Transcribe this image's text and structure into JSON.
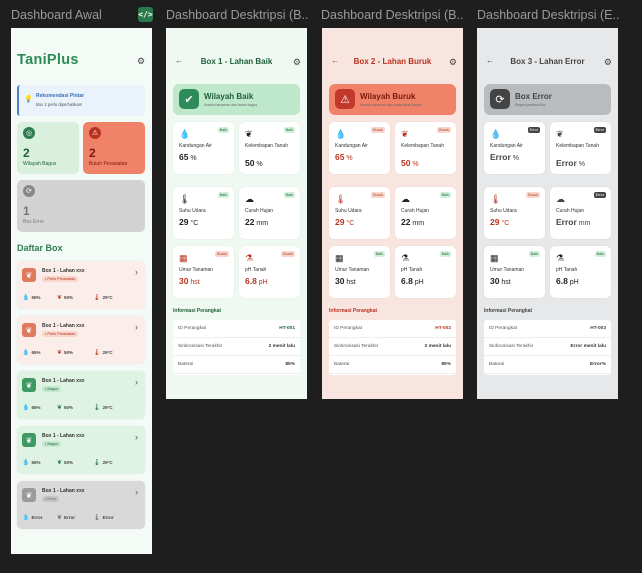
{
  "frame_titles": [
    "Dashboard Awal",
    "Dashboard Desktripsi (B...",
    "Dashboard Desktripsi (B...",
    "Dashboard Desktripsi (E..."
  ],
  "code_icon": "</>",
  "main": {
    "logo": "TaniPlus",
    "recommend_title": "Rekomendasi Pintar",
    "recommend_text": "Box 2 perlu diperhatikan!",
    "good_count": "2",
    "good_label": "Wilayah Bagus",
    "bad_count": "2",
    "bad_label": "Butuh Perawatan",
    "error_count": "1",
    "error_label": "Box Error",
    "list_title": "Daftar Box",
    "boxes": [
      {
        "title": "Box 1 - Lahan xxx",
        "status": "Perlu Perawatan",
        "kind": "bad",
        "moisture": "65%",
        "humidity": "50%",
        "temp": "29°C"
      },
      {
        "title": "Box 1 - Lahan xxx",
        "status": "Perlu Perawatan",
        "kind": "bad",
        "moisture": "65%",
        "humidity": "50%",
        "temp": "29°C"
      },
      {
        "title": "Box 1 - Lahan xxx",
        "status": "Bagus",
        "kind": "good",
        "moisture": "65%",
        "humidity": "50%",
        "temp": "29°C"
      },
      {
        "title": "Box 1 - Lahan xxx",
        "status": "Bagus",
        "kind": "good",
        "moisture": "65%",
        "humidity": "50%",
        "temp": "29°C"
      },
      {
        "title": "Box 1 - Lahan xxx",
        "status": "Error",
        "kind": "err",
        "moisture": "Error",
        "humidity": "Error",
        "temp": "Error"
      }
    ]
  },
  "details": [
    {
      "theme": "good",
      "title": "Box 1 - Lahan Baik",
      "banner_title": "Wilayah Baik",
      "banner_sub": "Kondisi tanaman dan tanah bagus",
      "sensors": [
        {
          "label": "Kandungan Air",
          "value": "65",
          "unit": " %",
          "badge": "Baik",
          "bstate": "good"
        },
        {
          "label": "Kelembapan Tanah",
          "value": "50",
          "unit": " %",
          "badge": "Baik",
          "bstate": "good"
        },
        {
          "label": "Suhu Udara",
          "value": "29",
          "unit": " °C",
          "badge": "Baik",
          "bstate": "good"
        },
        {
          "label": "Curah Hujan",
          "value": "22",
          "unit": " mm",
          "badge": "Baik",
          "bstate": "good"
        },
        {
          "label": "Umur Tanaman",
          "value": "30",
          "unit": " hst",
          "badge": "Buruk",
          "bstate": "bad"
        },
        {
          "label": "pH Tanah",
          "value": "6.8",
          "unit": " pH",
          "badge": "Buruk",
          "bstate": "bad"
        }
      ],
      "info_title": "Informasi Perangkat",
      "info": [
        {
          "k": "ID Perangkat",
          "v": "HT-001"
        },
        {
          "k": "Sinkronisasi Terakhir",
          "v": "2  menit lalu"
        },
        {
          "k": "Baterai",
          "v": "85%"
        }
      ]
    },
    {
      "theme": "bad",
      "title": "Box 2 - Lahan Buruk",
      "banner_title": "Wilayah Buruk",
      "banner_sub": "Kondisi tanaman dan tanah tidak bagus",
      "sensors": [
        {
          "label": "Kandungan Air",
          "value": "65",
          "unit": " %",
          "badge": "Buruk",
          "bstate": "bad"
        },
        {
          "label": "Kelembapan Tanah",
          "value": "50",
          "unit": " %",
          "badge": "Buruk",
          "bstate": "bad"
        },
        {
          "label": "Suhu Udara",
          "value": "29",
          "unit": " °C",
          "badge": "Buruk",
          "bstate": "bad"
        },
        {
          "label": "Curah Hujan",
          "value": "22",
          "unit": " mm",
          "badge": "Baik",
          "bstate": "good"
        },
        {
          "label": "Umur Tanaman",
          "value": "30",
          "unit": " hst",
          "badge": "Baik",
          "bstate": "good"
        },
        {
          "label": "pH Tanah",
          "value": "6.8",
          "unit": " pH",
          "badge": "Baik",
          "bstate": "good"
        }
      ],
      "info_title": "Informasi Perangkat",
      "info": [
        {
          "k": "ID Perangkat",
          "v": "HT-002"
        },
        {
          "k": "Sinkronisasi Terakhir",
          "v": "2  menit lalu"
        },
        {
          "k": "Baterai",
          "v": "85%"
        }
      ]
    },
    {
      "theme": "err",
      "title": "Box 3 - Lahan Error",
      "banner_title": "Box Error",
      "banner_sub": "Segera periksa Box",
      "sensors": [
        {
          "label": "Kandungan Air",
          "value": "Error",
          "unit": " %",
          "badge": "Error",
          "bstate": "err"
        },
        {
          "label": "Kelembapan Tanah",
          "value": "Error",
          "unit": " %",
          "badge": "Error",
          "bstate": "err"
        },
        {
          "label": "Suhu Udara",
          "value": "29",
          "unit": " °C",
          "badge": "Buruk",
          "bstate": "bad"
        },
        {
          "label": "Curah Hujan",
          "value": "Error",
          "unit": " mm",
          "badge": "Error",
          "bstate": "err"
        },
        {
          "label": "Umur Tanaman",
          "value": "30",
          "unit": " hst",
          "badge": "Baik",
          "bstate": "good"
        },
        {
          "label": "pH Tanah",
          "value": "6.8",
          "unit": " pH",
          "badge": "Baik",
          "bstate": "good"
        }
      ],
      "info_title": "Informasi Perangkat",
      "info": [
        {
          "k": "ID Perangkat",
          "v": "HT-003"
        },
        {
          "k": "Sinkronisasi Terakhir",
          "v": "Error  menit lalu"
        },
        {
          "k": "Baterai",
          "v": "Error%"
        }
      ]
    }
  ],
  "colors": {
    "canvas": "#1e1e1e",
    "good_bg": "#e8f5ec",
    "bad_bg": "#f6dcd6",
    "err_bg": "#dde0e2",
    "good_accent": "#2e8b57",
    "bad_accent": "#c0392b",
    "err_accent": "#555555"
  },
  "icons": {
    "moisture": "droplet-icon",
    "humidity": "sprout-icon",
    "temp": "thermometer-icon",
    "rain": "cloud-rain-icon",
    "age": "calendar-icon",
    "ph": "flask-icon"
  }
}
